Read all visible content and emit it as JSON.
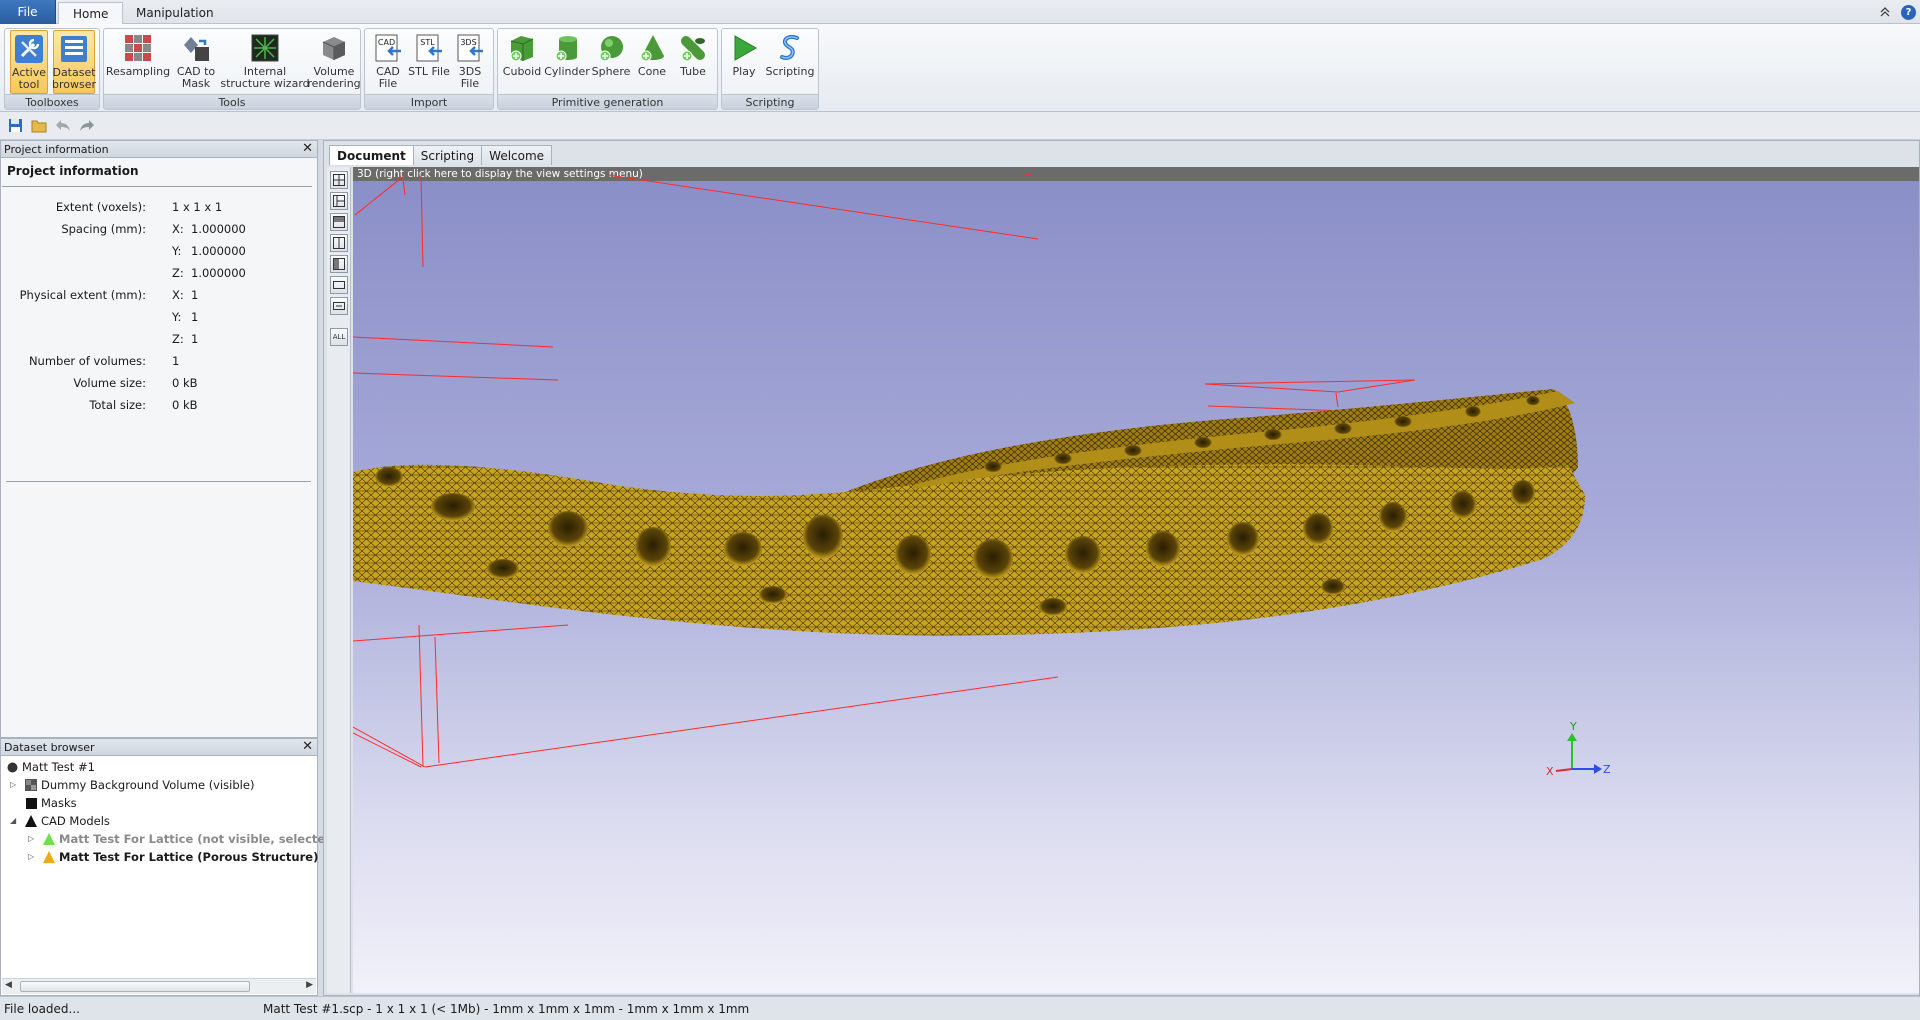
{
  "tabs": {
    "file": "File",
    "home": "Home",
    "manipulation": "Manipulation"
  },
  "ribbon": {
    "toolboxes": {
      "label": "Toolboxes",
      "active_tool": [
        "Active",
        "tool"
      ],
      "dataset_browser": [
        "Dataset",
        "browser"
      ]
    },
    "tools": {
      "label": "Tools",
      "resampling": [
        "Resampling"
      ],
      "cad_to_mask": [
        "CAD to",
        "Mask"
      ],
      "internal_structure": [
        "Internal",
        "structure wizard"
      ],
      "volume_rendering": [
        "Volume",
        "rendering"
      ]
    },
    "import": {
      "label": "Import",
      "cad_file": [
        "CAD",
        "File"
      ],
      "stl_file": [
        "STL File"
      ],
      "file_3ds": [
        "3DS",
        "File"
      ]
    },
    "primitive": {
      "label": "Primitive generation",
      "cuboid": [
        "Cuboid"
      ],
      "cylinder": [
        "Cylinder"
      ],
      "sphere": [
        "Sphere"
      ],
      "cone": [
        "Cone"
      ],
      "tube": [
        "Tube"
      ]
    },
    "scripting": {
      "label": "Scripting",
      "play": [
        "Play"
      ],
      "scripting": [
        "Scripting"
      ]
    },
    "icon_text": {
      "cad": "CAD",
      "stl": "STL",
      "3ds": "3DS"
    }
  },
  "project_panel": {
    "header": "Project information",
    "title": "Project information",
    "extent_label": "Extent (voxels):",
    "extent_value": "1 x 1 x 1",
    "spacing_label": "Spacing (mm):",
    "spacing": {
      "x": "1.000000",
      "y": "1.000000",
      "z": "1.000000"
    },
    "physical_label": "Physical extent (mm):",
    "physical": {
      "x": "1",
      "y": "1",
      "z": "1"
    },
    "axis": {
      "x": "X:",
      "y": "Y:",
      "z": "Z:"
    },
    "num_volumes_label": "Number of volumes:",
    "num_volumes": "1",
    "volume_size_label": "Volume size:",
    "volume_size": "0 kB",
    "total_size_label": "Total size:",
    "total_size": "0 kB"
  },
  "dataset_panel": {
    "header": "Dataset browser",
    "items": [
      "Matt Test #1",
      "Dummy Background Volume (visible)",
      "Masks",
      "CAD Models",
      "Matt Test For Lattice (not visible, selected)",
      "Matt Test For Lattice (Porous Structure) (visibl"
    ]
  },
  "document": {
    "tabs": [
      "Document",
      "Scripting",
      "Welcome"
    ],
    "view_banner": "3D (right click here to display the view settings menu)",
    "view_buttons": [
      "",
      "",
      "",
      "",
      "",
      "",
      "",
      "ALL"
    ],
    "axes": {
      "x": "X",
      "y": "Y",
      "z": "Z"
    }
  },
  "status": {
    "left": "File loaded...",
    "right": "Matt Test #1.scp - 1 x 1 x 1 (< 1Mb) - 1mm x 1mm x 1mm - 1mm x 1mm x 1mm"
  },
  "colors": {
    "mesh": "#c9a41f",
    "bounding_box": "#ff2a2a",
    "accent": "#2a5d9f"
  }
}
